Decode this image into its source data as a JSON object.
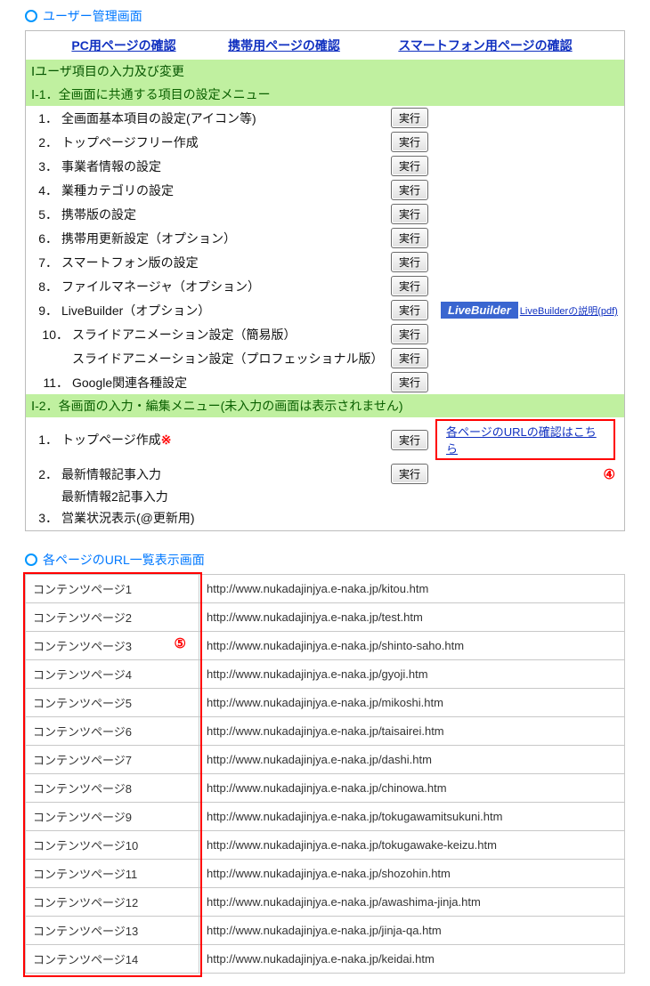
{
  "heading1": "ユーザー管理画面",
  "top_links": {
    "pc": "PC用ページの確認",
    "mobile": "携帯用ページの確認",
    "smart": "スマートフォン用ページの確認"
  },
  "section1_title": "Ⅰユーザ項目の入力及び変更",
  "section1_1_title": "Ⅰ-1．全画面に共通する項目の設定メニュー",
  "exec_label": "実行",
  "rows1": [
    {
      "num": "1．",
      "label": "全画面基本項目の設定(アイコン等)"
    },
    {
      "num": "2．",
      "label": "トップページフリー作成"
    },
    {
      "num": "3．",
      "label": "事業者情報の設定"
    },
    {
      "num": "4．",
      "label": "業種カテゴリの設定"
    },
    {
      "num": "5．",
      "label": "携帯版の設定"
    },
    {
      "num": "6．",
      "label": "携帯用更新設定（オプション）"
    },
    {
      "num": "7．",
      "label": "スマートフォン版の設定"
    },
    {
      "num": "8．",
      "label": "ファイルマネージャ（オプション）"
    }
  ],
  "row_lb": {
    "num": "9．",
    "label": "LiveBuilder（オプション）",
    "badge": "LiveBuilder",
    "pdf": "LiveBuilderの説明(pdf)"
  },
  "row10a": {
    "num": "10．",
    "label": "スライドアニメーション設定（簡易版）"
  },
  "row10b": {
    "label": "スライドアニメーション設定（プロフェッショナル版）"
  },
  "row11": {
    "num": "11．",
    "label": "Google関連各種設定"
  },
  "section1_2_title": "Ⅰ-2．各画面の入力・編集メニュー(未入力の画面は表示されません)",
  "rows2": {
    "r1": {
      "num": "1．",
      "label": "トップページ作成",
      "star": "※"
    },
    "r2": {
      "num": "2．",
      "label": "最新情報記事入力"
    },
    "r2b": {
      "label": "最新情報2記事入力"
    },
    "r3": {
      "num": "3．",
      "label": "営業状況表示(@更新用)"
    }
  },
  "url_confirm_link": "各ページのURLの確認はこちら",
  "circled4": "④",
  "heading2": "各ページのURL一覧表示画面",
  "circled5": "⑤",
  "url_rows": [
    {
      "name": "コンテンツページ1",
      "url": "http://www.nukadajinjya.e-naka.jp/kitou.htm"
    },
    {
      "name": "コンテンツページ2",
      "url": "http://www.nukadajinjya.e-naka.jp/test.htm"
    },
    {
      "name": "コンテンツページ3",
      "url": "http://www.nukadajinjya.e-naka.jp/shinto-saho.htm"
    },
    {
      "name": "コンテンツページ4",
      "url": "http://www.nukadajinjya.e-naka.jp/gyoji.htm"
    },
    {
      "name": "コンテンツページ5",
      "url": "http://www.nukadajinjya.e-naka.jp/mikoshi.htm"
    },
    {
      "name": "コンテンツページ6",
      "url": "http://www.nukadajinjya.e-naka.jp/taisairei.htm"
    },
    {
      "name": "コンテンツページ7",
      "url": "http://www.nukadajinjya.e-naka.jp/dashi.htm"
    },
    {
      "name": "コンテンツページ8",
      "url": "http://www.nukadajinjya.e-naka.jp/chinowa.htm"
    },
    {
      "name": "コンテンツページ9",
      "url": "http://www.nukadajinjya.e-naka.jp/tokugawamitsukuni.htm"
    },
    {
      "name": "コンテンツページ10",
      "url": "http://www.nukadajinjya.e-naka.jp/tokugawake-keizu.htm"
    },
    {
      "name": "コンテンツページ11",
      "url": "http://www.nukadajinjya.e-naka.jp/shozohin.htm"
    },
    {
      "name": "コンテンツページ12",
      "url": "http://www.nukadajinjya.e-naka.jp/awashima-jinja.htm"
    },
    {
      "name": "コンテンツページ13",
      "url": "http://www.nukadajinjya.e-naka.jp/jinja-qa.htm"
    },
    {
      "name": "コンテンツページ14",
      "url": "http://www.nukadajinjya.e-naka.jp/keidai.htm"
    }
  ]
}
